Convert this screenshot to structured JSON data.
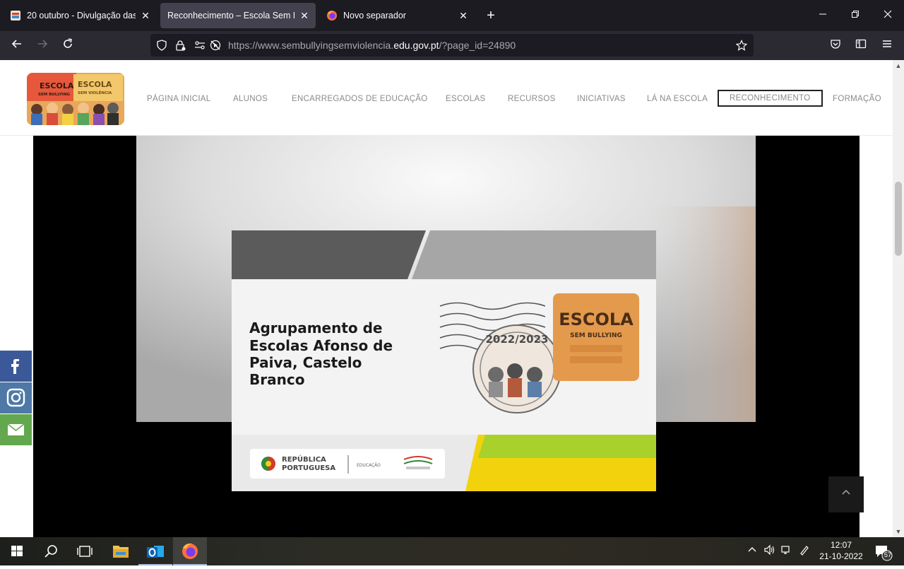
{
  "browser": {
    "tabs": [
      {
        "title": "20 outubro - Divulgação das esc",
        "active": false
      },
      {
        "title": "Reconhecimento – Escola Sem Bully",
        "active": true
      },
      {
        "title": "Novo separador",
        "active": false
      }
    ],
    "url_prefix": "https://www.sembullyingsemviolencia.",
    "url_domain": "edu.gov.pt",
    "url_suffix": "/?page_id=24890"
  },
  "site": {
    "logo_line1": "ESCOLA",
    "logo_line2": "SEM BULLYING",
    "logo_line3": "ESCOLA",
    "logo_line4": "SEM VIOLÊNCIA",
    "nav": [
      {
        "label": "PÁGINA INICIAL"
      },
      {
        "label": "ALUNOS"
      },
      {
        "label": "ENCARREGADOS DE EDUCAÇÃO"
      },
      {
        "label": "ESCOLAS"
      },
      {
        "label": "RECURSOS"
      },
      {
        "label": "INICIATIVAS"
      },
      {
        "label": "LÁ NA ESCOLA"
      },
      {
        "label": "RECONHECIMENTO",
        "active": true
      },
      {
        "label": "FORMAÇÃO"
      }
    ]
  },
  "video": {
    "school_name": "Agrupamento de Escolas Afonso de Paiva, Castelo Branco",
    "school_lines": [
      "Agrupamento de",
      "Escolas Afonso de",
      "Paiva, Castelo",
      "Branco"
    ],
    "seal_year": "2022/2023",
    "badge_line1": "ESCOLA",
    "badge_line2": "SEM BULLYING",
    "footer_org_line1": "REPÚBLICA",
    "footer_org_line2": "PORTUGUESA",
    "footer_ministry": "EDUCAÇÃO"
  },
  "social": [
    "facebook",
    "instagram",
    "email"
  ],
  "taskbar": {
    "time": "12:07",
    "date": "21-10-2022",
    "notifications": "57"
  },
  "colors": {
    "tab_active": "#42414d",
    "chrome_dark": "#1c1b22",
    "facebook": "#3b5998",
    "instagram": "#4e78a6",
    "email": "#63a84f",
    "badge_orange": "#e49a4c",
    "footer_yellow": "#f2d20c",
    "footer_green": "#a8d12b"
  }
}
